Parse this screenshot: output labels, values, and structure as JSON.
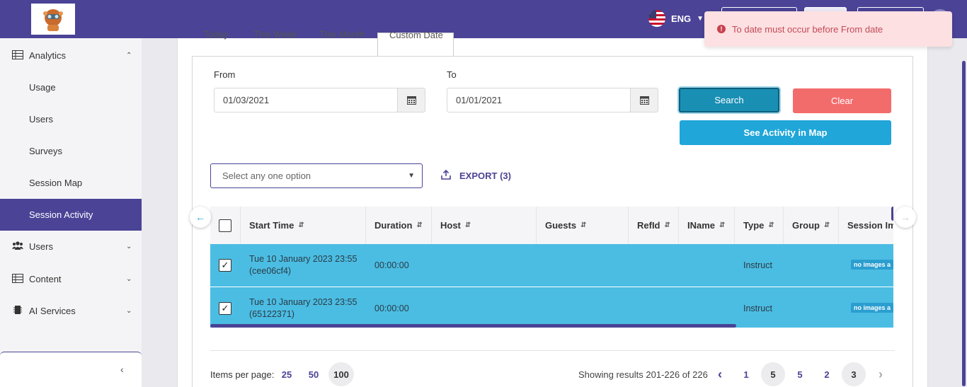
{
  "header": {
    "language": "ENG",
    "toast_message": "To date must occur before From date"
  },
  "sidebar": {
    "items": [
      {
        "label": "Analytics",
        "icon": "table-icon"
      },
      {
        "label": "Usage"
      },
      {
        "label": "Users"
      },
      {
        "label": "Surveys"
      },
      {
        "label": "Session Map"
      },
      {
        "label": "Session Activity",
        "active": true
      },
      {
        "label": "Users",
        "icon": "users-icon"
      },
      {
        "label": "Content",
        "icon": "table-icon"
      },
      {
        "label": "AI Services",
        "icon": "chip-icon"
      }
    ]
  },
  "tabs": [
    "Today",
    "This Week",
    "This Month",
    "Custom Date"
  ],
  "filters": {
    "from_label": "From",
    "from_value": "01/03/2021",
    "to_label": "To",
    "to_value": "01/01/2021",
    "search_label": "Search",
    "clear_label": "Clear",
    "map_label": "See Activity in Map",
    "select_placeholder": "Select any one option",
    "export_label": "EXPORT (3)"
  },
  "table": {
    "columns": [
      "Start Time",
      "Duration",
      "Host",
      "Guests",
      "RefId",
      "IName",
      "Type",
      "Group",
      "Session Im"
    ],
    "rows": [
      {
        "start_time": "Tue 10 January 2023 23:55",
        "id": "(cee06cf4)",
        "duration": "00:00:00",
        "type": "Instruct",
        "badge": "no images a",
        "checked": true
      },
      {
        "start_time": "Tue 10 January 2023 23:55",
        "id": "(65122371)",
        "duration": "00:00:00",
        "type": "Instruct",
        "badge": "no images a",
        "checked": true
      }
    ]
  },
  "pagination": {
    "items_per_page_label": "Items per page:",
    "sizes": [
      "25",
      "50",
      "100"
    ],
    "selected_size": "100",
    "results_text": "Showing results 201-226 of 226",
    "pages": [
      "1",
      "5",
      "5",
      "2",
      "3"
    ],
    "current_pages": [
      "5",
      "3"
    ]
  },
  "colors": {
    "brand": "#4a4396",
    "row_selected": "#4bbde3",
    "search": "#1a8fb4",
    "clear": "#f36c6c",
    "map": "#20a6d8",
    "toast_bg": "#fde0e2"
  }
}
